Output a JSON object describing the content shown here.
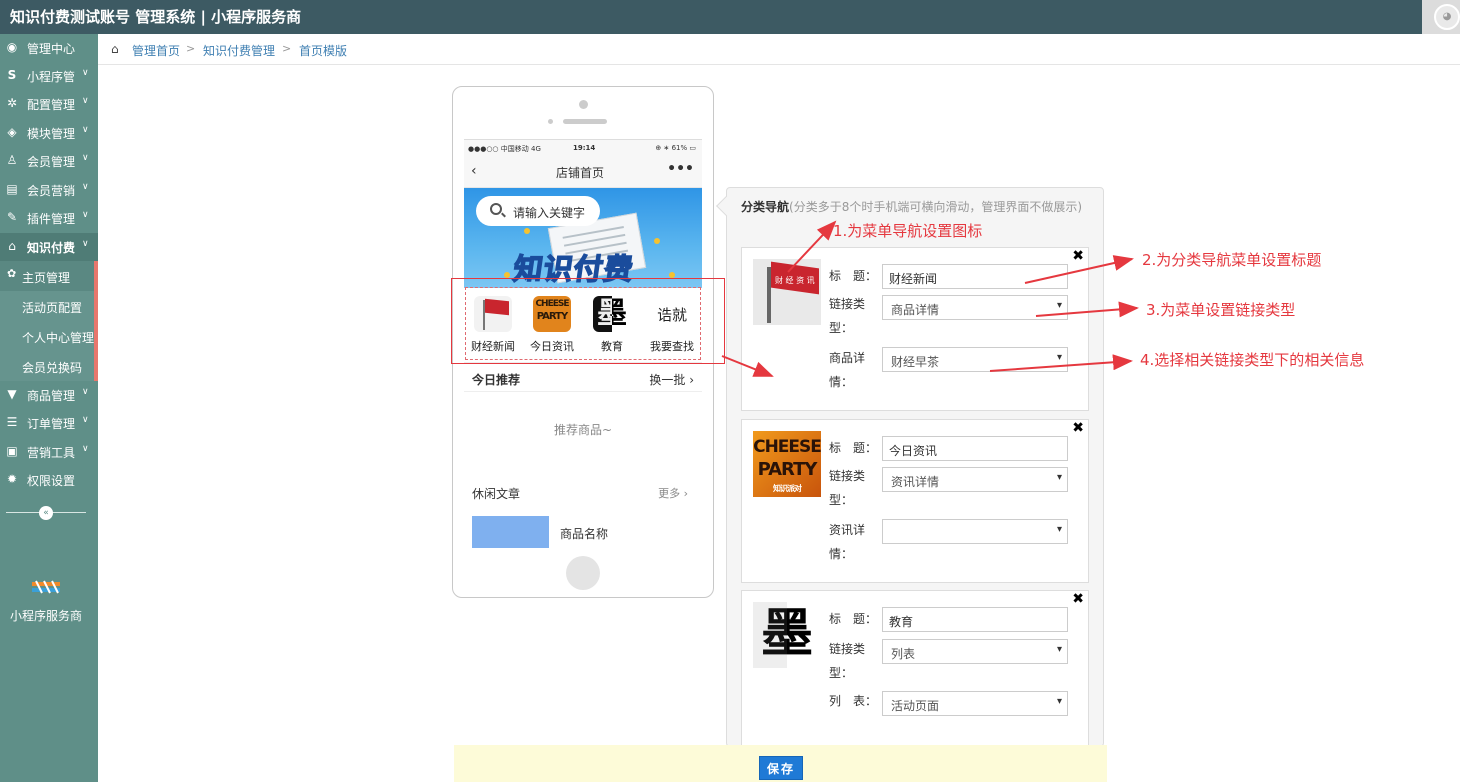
{
  "app": {
    "title": "知识付费测试账号 管理系统 | 小程序服务商"
  },
  "sidebar": {
    "items": [
      {
        "label": "管理中心",
        "icon": "dashboard-icon",
        "glyph": "◉",
        "has_chevron": false
      },
      {
        "label": "小程序管",
        "icon": "miniprogram-icon",
        "glyph": "S",
        "has_chevron": true
      },
      {
        "label": "配置管理",
        "icon": "gears-icon",
        "glyph": "✲",
        "has_chevron": true
      },
      {
        "label": "模块管理",
        "icon": "cubes-icon",
        "glyph": "◈",
        "has_chevron": true
      },
      {
        "label": "会员管理",
        "icon": "user-icon",
        "glyph": "♙",
        "has_chevron": true
      },
      {
        "label": "会员营销",
        "icon": "id-card-icon",
        "glyph": "▤",
        "has_chevron": true
      },
      {
        "label": "插件管理",
        "icon": "plug-icon",
        "glyph": "✎",
        "has_chevron": true
      },
      {
        "label": "知识付费",
        "icon": "home-icon",
        "glyph": "⌂",
        "has_chevron": true
      },
      {
        "label": "主页管理",
        "icon": "gear-icon",
        "glyph": "✿",
        "has_chevron": false
      },
      {
        "label": "活动页配置"
      },
      {
        "label": "个人中心管理"
      },
      {
        "label": "会员兑换码"
      },
      {
        "label": "商品管理",
        "icon": "cart-icon",
        "glyph": "▼",
        "has_chevron": true
      },
      {
        "label": "订单管理",
        "icon": "list-icon",
        "glyph": "☰",
        "has_chevron": true
      },
      {
        "label": "营销工具",
        "icon": "briefcase-icon",
        "glyph": "▣",
        "has_chevron": true
      },
      {
        "label": "权限设置",
        "icon": "cog-icon",
        "glyph": "✹",
        "has_chevron": false
      }
    ],
    "collapse_glyph": "«",
    "brand_label": "小程序服务商"
  },
  "breadcrumb": {
    "items": [
      "管理首页",
      "知识付费管理",
      "首页模版"
    ],
    "separator": ">"
  },
  "phone": {
    "status": {
      "left": "●●●○○ 中国移动  4G",
      "time": "19:14",
      "right": "⊕ ∗ 61% ▭"
    },
    "nav_title": "店铺首页",
    "back_glyph": "‹",
    "more_glyph": "•••",
    "search_placeholder": "请输入关键字",
    "banner_text": "知识付费",
    "nav_icons": [
      {
        "label": "财经新闻",
        "image": "red-flag"
      },
      {
        "label": "今日资讯",
        "image": "cheese-party",
        "art": [
          "CHEESE",
          "PARTY"
        ]
      },
      {
        "label": "教育",
        "image": "ink-character",
        "art": "墨"
      },
      {
        "label": "我要查找",
        "image": "calligraphy",
        "art": "诰就"
      }
    ],
    "recommend": {
      "title": "今日推荐",
      "action": "换一批",
      "empty": "推荐商品~"
    },
    "articles": {
      "title": "休闲文章",
      "more": "更多"
    },
    "product_name": "商品名称"
  },
  "panel": {
    "title": "分类导航",
    "hint": "(分类多于8个时手机端可横向滑动，管理界面不做展示)",
    "labels": {
      "title": "标　题：",
      "link_type": "链接类型：",
      "close": "✖"
    },
    "cards": [
      {
        "thumb": "red-flag",
        "thumb_text": "财 经 资 讯",
        "title_value": "财经新闻",
        "link_type": "商品详情",
        "detail_label": "商品详情：",
        "detail_value": "财经早茶"
      },
      {
        "thumb": "cheese-party",
        "thumb_art": [
          "CHEESE",
          "PARTY",
          "知识派对"
        ],
        "title_value": "今日资讯",
        "link_type": "资讯详情",
        "detail_label": "资讯详情：",
        "detail_value": ""
      },
      {
        "thumb": "ink-character",
        "thumb_art": "墨",
        "title_value": "教育",
        "link_type": "列表",
        "detail_label": "列　表：",
        "detail_value": "活动页面"
      }
    ]
  },
  "save": {
    "label": "保存"
  },
  "annotations": [
    "1.为菜单导航设置图标",
    "2.为分类导航菜单设置标题",
    "3.为菜单设置链接类型",
    "4.选择相关链接类型下的相关信息"
  ],
  "colors": {
    "topbar": "#3d5a63",
    "sidebar": "#5f8f88",
    "accent": "#e5383f",
    "link": "#3f7fb2",
    "save": "#1f7ad6"
  }
}
